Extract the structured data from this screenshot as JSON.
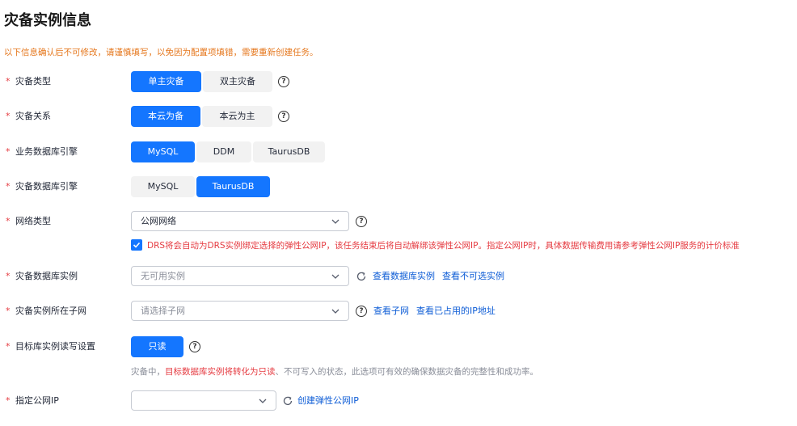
{
  "page": {
    "title": "灾备实例信息",
    "notice": "以下信息确认后不可修改，请谨慎填写，以免因为配置项填错，需要重新创建任务。"
  },
  "fields": {
    "dr_type": {
      "label": "灾备类型",
      "options": [
        "单主灾备",
        "双主灾备"
      ],
      "selected": "单主灾备"
    },
    "dr_relation": {
      "label": "灾备关系",
      "options": [
        "本云为备",
        "本云为主"
      ],
      "selected": "本云为备"
    },
    "biz_engine": {
      "label": "业务数据库引擎",
      "options": [
        "MySQL",
        "DDM",
        "TaurusDB"
      ],
      "selected": "MySQL"
    },
    "dr_engine": {
      "label": "灾备数据库引擎",
      "options": [
        "MySQL",
        "TaurusDB"
      ],
      "selected": "TaurusDB"
    },
    "network": {
      "label": "网络类型",
      "value": "公网网络",
      "checkbox_text": "DRS将会自动为DRS实例绑定选择的弹性公网IP，该任务结束后将自动解绑该弹性公网IP。指定公网IP时，具体数据传输费用请参考弹性公网IP服务的计价标准",
      "checked": true
    },
    "dr_instance": {
      "label": "灾备数据库实例",
      "placeholder": "无可用实例",
      "links": [
        "查看数据库实例",
        "查看不可选实例"
      ]
    },
    "subnet": {
      "label": "灾备实例所在子网",
      "placeholder": "请选择子网",
      "links": [
        "查看子网",
        "查看已占用的IP地址"
      ]
    },
    "rw_setting": {
      "label": "目标库实例读写设置",
      "button": "只读",
      "hint_prefix": "灾备中，",
      "hint_red": "目标数据库实例将转化为只读",
      "hint_suffix": "、不可写入的状态，此选项可有效的确保数据灾备的完整性和成功率。"
    },
    "public_ip": {
      "label": "指定公网IP",
      "value": "",
      "link": "创建弹性公网IP"
    }
  },
  "required_mark": "*",
  "colors": {
    "primary": "#1476ff",
    "required": "#e53a40",
    "notice": "#e5761b",
    "link": "#0d5cd6"
  }
}
